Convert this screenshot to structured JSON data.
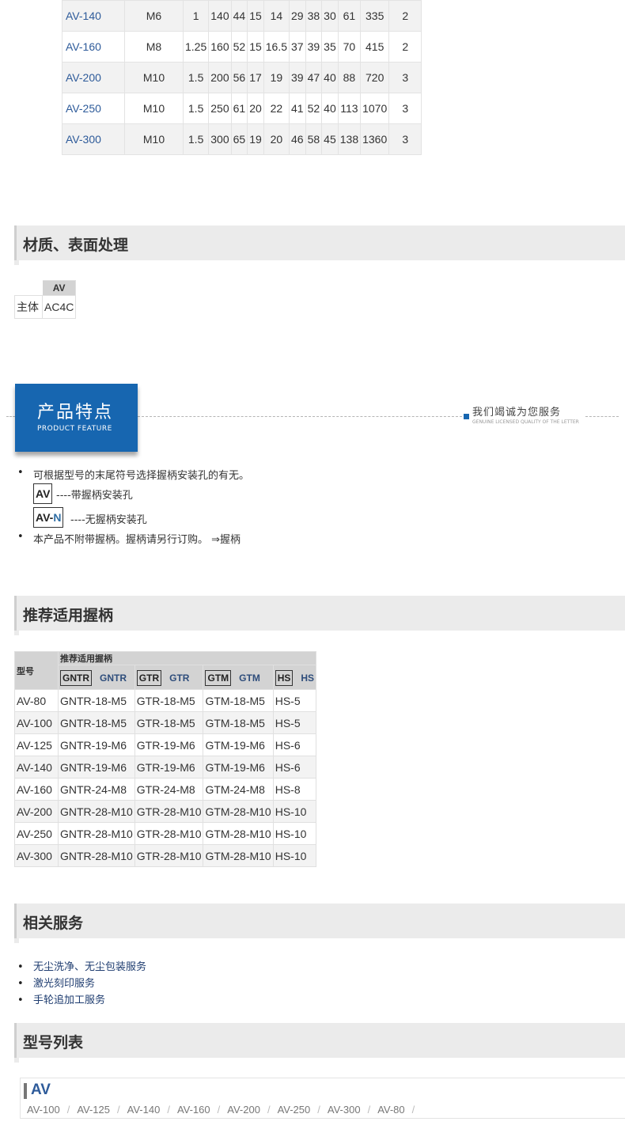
{
  "dimensions": {
    "rows": [
      [
        "AV-140",
        "M6",
        "1",
        "140",
        "44",
        "15",
        "14",
        "29",
        "38",
        "30",
        "61",
        "335",
        "2"
      ],
      [
        "AV-160",
        "M8",
        "1.25",
        "160",
        "52",
        "15",
        "16.5",
        "37",
        "39",
        "35",
        "70",
        "415",
        "2"
      ],
      [
        "AV-200",
        "M10",
        "1.5",
        "200",
        "56",
        "17",
        "19",
        "39",
        "47",
        "40",
        "88",
        "720",
        "3"
      ],
      [
        "AV-250",
        "M10",
        "1.5",
        "250",
        "61",
        "20",
        "22",
        "41",
        "52",
        "40",
        "113",
        "1070",
        "3"
      ],
      [
        "AV-300",
        "M10",
        "1.5",
        "300",
        "65",
        "19",
        "20",
        "46",
        "58",
        "45",
        "138",
        "1360",
        "3"
      ]
    ]
  },
  "material": {
    "title": "材质、表面处理",
    "header": "AV",
    "label": "主体",
    "value": "AC4C"
  },
  "feature": {
    "title_cn": "产品特点",
    "title_en": "PRODUCT FEATURE",
    "service_cn": "我们竭诚为您服务",
    "service_en": "GENUINE LICENSED QUALITY OF THE LETTER",
    "bullet1": "可根据型号的末尾符号选择握柄安装孔的有无。",
    "code_av": "AV",
    "code_av_desc": "----带握柄安装孔",
    "code_avn_base": "AV-",
    "code_avn_suffix": "N",
    "code_avn_desc": "----无握柄安装孔",
    "bullet2": "本产品不附带握柄。握柄请另行订购。 ⇒握柄"
  },
  "handles": {
    "title": "推荐适用握柄",
    "col_model": "型号",
    "col_group": "推荐适用握柄",
    "types": [
      {
        "box": "GNTR",
        "name": "GNTR"
      },
      {
        "box": "GTR",
        "name": "GTR"
      },
      {
        "box": "GTM",
        "name": "GTM"
      },
      {
        "box": "HS",
        "name": "HS"
      }
    ],
    "rows": [
      [
        "AV-80",
        "GNTR-18-M5",
        "GTR-18-M5",
        "GTM-18-M5",
        "HS-5"
      ],
      [
        "AV-100",
        "GNTR-18-M5",
        "GTR-18-M5",
        "GTM-18-M5",
        "HS-5"
      ],
      [
        "AV-125",
        "GNTR-19-M6",
        "GTR-19-M6",
        "GTM-19-M6",
        "HS-6"
      ],
      [
        "AV-140",
        "GNTR-19-M6",
        "GTR-19-M6",
        "GTM-19-M6",
        "HS-6"
      ],
      [
        "AV-160",
        "GNTR-24-M8",
        "GTR-24-M8",
        "GTM-24-M8",
        "HS-8"
      ],
      [
        "AV-200",
        "GNTR-28-M10",
        "GTR-28-M10",
        "GTM-28-M10",
        "HS-10"
      ],
      [
        "AV-250",
        "GNTR-28-M10",
        "GTR-28-M10",
        "GTM-28-M10",
        "HS-10"
      ],
      [
        "AV-300",
        "GNTR-28-M10",
        "GTR-28-M10",
        "GTM-28-M10",
        "HS-10"
      ]
    ]
  },
  "services": {
    "title": "相关服务",
    "items": [
      "无尘洗净、无尘包装服务",
      "激光刻印服务",
      "手轮追加工服务"
    ]
  },
  "model_list": {
    "title": "型号列表",
    "group": "AV",
    "items": [
      "AV-100",
      "AV-125",
      "AV-140",
      "AV-160",
      "AV-200",
      "AV-250",
      "AV-300",
      "AV-80"
    ]
  },
  "colors": {
    "accent_blue": "#1766b0",
    "link_blue": "#2e5b9a",
    "header_gray": "#ebebeb"
  }
}
